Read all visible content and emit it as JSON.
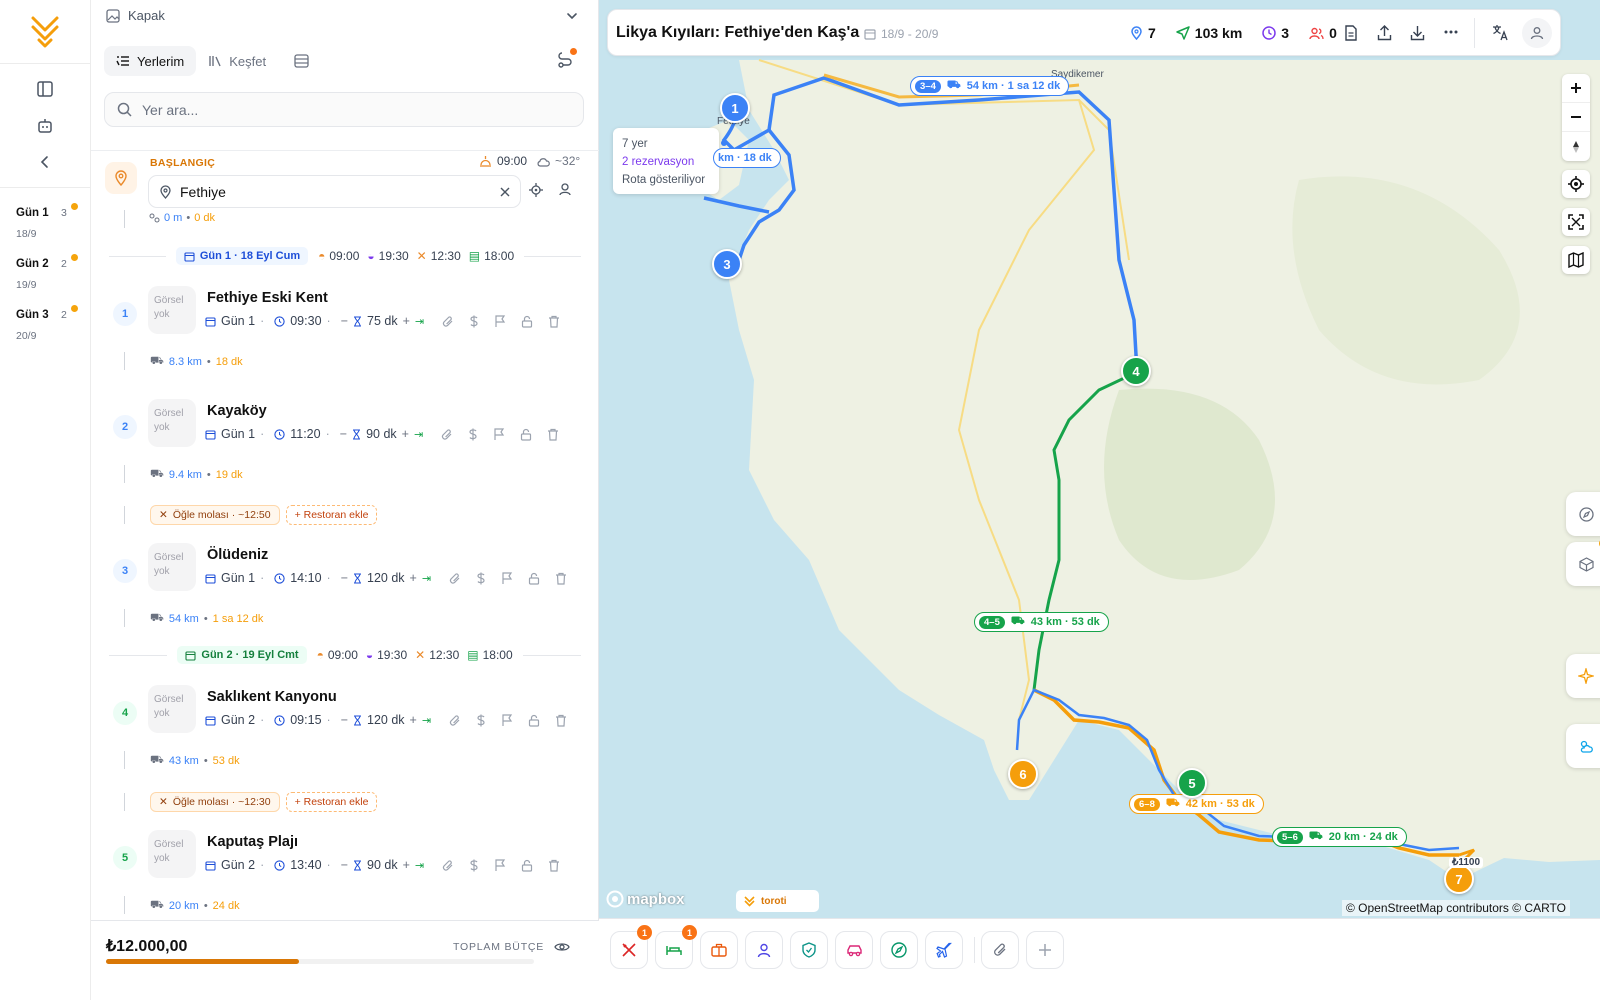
{
  "rail": {
    "days": [
      {
        "label": "Gün 1",
        "count": "3",
        "date": "18/9"
      },
      {
        "label": "Gün 2",
        "count": "2",
        "date": "19/9"
      },
      {
        "label": "Gün 3",
        "count": "2",
        "date": "20/9"
      }
    ]
  },
  "panel": {
    "cover_label": "Kapak",
    "tabs": {
      "places": "Yerlerim",
      "explore": "Keşfet"
    },
    "search_placeholder": "Yer ara...",
    "start": {
      "label": "BAŞLANGIÇ",
      "time": "09:00",
      "weather": "~32°",
      "value": "Fethiye",
      "leg_dist": "0 m",
      "leg_time": "0 dk"
    },
    "days": [
      {
        "pill": "Gün 1 · 18 Eyl Cum",
        "t1": "09:00",
        "t2": "19:30",
        "t3": "12:30",
        "t4": "18:00"
      },
      {
        "pill": "Gün 2 · 19 Eyl Cmt",
        "t1": "09:00",
        "t2": "19:30",
        "t3": "12:30",
        "t4": "18:00"
      }
    ],
    "no_image": "Görsel yok",
    "stops": [
      {
        "num": "1",
        "name": "Fethiye Eski Kent",
        "day": "Gün 1",
        "time": "09:30",
        "dur": "75 dk",
        "leg_dist": "8.3 km",
        "leg_time": "18 dk"
      },
      {
        "num": "2",
        "name": "Kayaköy",
        "day": "Gün 1",
        "time": "11:20",
        "dur": "90 dk",
        "leg_dist": "9.4 km",
        "leg_time": "19 dk"
      },
      {
        "num": "3",
        "name": "Ölüdeniz",
        "day": "Gün 1",
        "time": "14:10",
        "dur": "120 dk",
        "leg_dist": "54 km",
        "leg_time": "1 sa 12 dk"
      },
      {
        "num": "4",
        "name": "Saklıkent Kanyonu",
        "day": "Gün 2",
        "time": "09:15",
        "dur": "120 dk",
        "leg_dist": "43 km",
        "leg_time": "53 dk"
      },
      {
        "num": "5",
        "name": "Kaputaş Plajı",
        "day": "Gün 2",
        "time": "13:40",
        "dur": "90 dk",
        "leg_dist": "20 km",
        "leg_time": "24 dk"
      }
    ],
    "lunch": [
      {
        "label": "Öğle molası · ~12:50",
        "add": "+ Restoran ekle"
      },
      {
        "label": "Öğle molası · ~12:30",
        "add": "+ Restoran ekle"
      }
    ],
    "budget": {
      "amount": "₺12.000,00",
      "label": "TOPLAM BÜTÇE",
      "progress": 0.45
    }
  },
  "map": {
    "title": "Likya Kıyıları: Fethiye'den Kaş'a",
    "date_range": "18/9 - 20/9",
    "stats": {
      "places": "7",
      "distance": "103 km",
      "time": "3",
      "people": "0"
    },
    "info": {
      "places": "7 yer",
      "reservations": "2 rezervasyon",
      "route": "Rota gösteriliyor"
    },
    "route_labels": [
      {
        "key": "3–4",
        "text": "54 km · 1 sa 12 dk"
      },
      {
        "key": "",
        "text": "km · 18 dk"
      },
      {
        "key": "4–5",
        "text": "43 km · 53 dk"
      },
      {
        "key": "6–8",
        "text": "42 km · 53 dk"
      },
      {
        "key": "5–6",
        "text": "20 km · 24 dk"
      }
    ],
    "place_labels": {
      "fethiye": "Fethiye",
      "saydikemer": "Saydikemer"
    },
    "price_tag": "₺1100",
    "attribution": "© OpenStreetMap contributors © CARTO",
    "mapbox": "mapbox",
    "brand": "toroti",
    "bottom_badges": {
      "food": "1",
      "hotel": "1"
    },
    "colors": {
      "blue": "#3b82f6",
      "green": "#16a34a",
      "orange": "#f59e0b",
      "accent": "#f97316"
    }
  }
}
